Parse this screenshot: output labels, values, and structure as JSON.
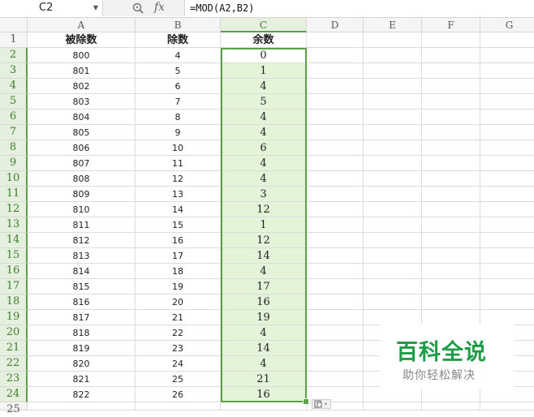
{
  "formula_bar": {
    "cell_ref": "C2",
    "fx_label": "fx",
    "formula": "=MOD(A2,B2)"
  },
  "sheet": {
    "columns": [
      "A",
      "B",
      "C",
      "D",
      "E",
      "F",
      "G"
    ],
    "row_numbers": [
      "1",
      "2",
      "3",
      "4",
      "5",
      "6",
      "7",
      "8",
      "9",
      "10",
      "11",
      "12",
      "13",
      "14",
      "15",
      "16",
      "17",
      "18",
      "19",
      "20",
      "21",
      "22",
      "23",
      "24",
      "25"
    ],
    "headers": {
      "A": "被除数",
      "B": "除数",
      "C": "余数"
    },
    "rows": [
      [
        "800",
        "4",
        "0"
      ],
      [
        "801",
        "5",
        "1"
      ],
      [
        "802",
        "6",
        "4"
      ],
      [
        "803",
        "7",
        "5"
      ],
      [
        "804",
        "8",
        "4"
      ],
      [
        "805",
        "9",
        "4"
      ],
      [
        "806",
        "10",
        "6"
      ],
      [
        "807",
        "11",
        "4"
      ],
      [
        "808",
        "12",
        "4"
      ],
      [
        "809",
        "13",
        "3"
      ],
      [
        "810",
        "14",
        "12"
      ],
      [
        "811",
        "15",
        "1"
      ],
      [
        "812",
        "16",
        "12"
      ],
      [
        "813",
        "17",
        "14"
      ],
      [
        "814",
        "18",
        "4"
      ],
      [
        "815",
        "19",
        "17"
      ],
      [
        "816",
        "20",
        "16"
      ],
      [
        "817",
        "21",
        "19"
      ],
      [
        "818",
        "22",
        "4"
      ],
      [
        "819",
        "23",
        "14"
      ],
      [
        "820",
        "24",
        "4"
      ],
      [
        "821",
        "25",
        "21"
      ],
      [
        "822",
        "26",
        "16"
      ]
    ],
    "active_cell": "C2",
    "selected_range": "C2:C24",
    "selection_color": "#5aa14a"
  },
  "watermark": {
    "title": "百科全说",
    "subtitle": "助你轻松解决"
  }
}
